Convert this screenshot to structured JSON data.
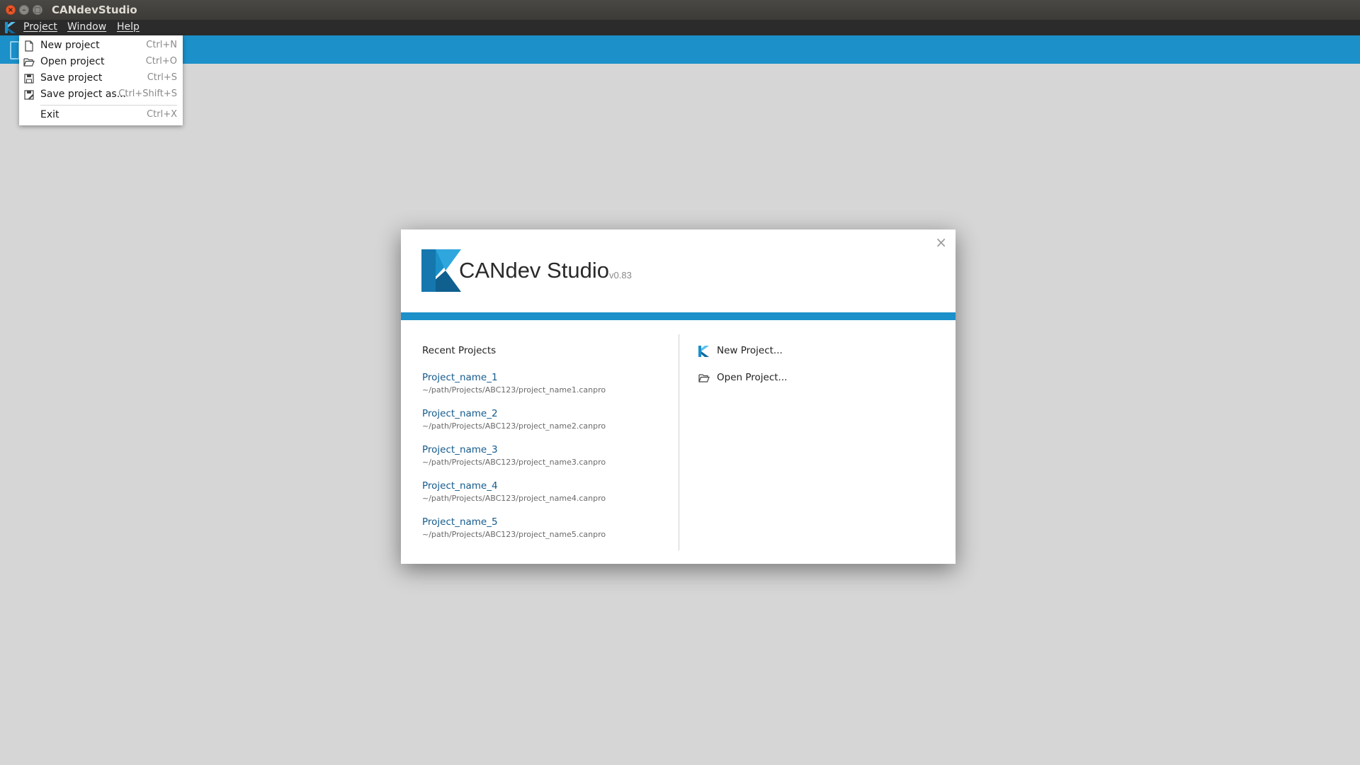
{
  "window": {
    "title": "CANdevStudio"
  },
  "menubar": {
    "items": [
      {
        "label": "Project"
      },
      {
        "label": "Window"
      },
      {
        "label": "Help"
      }
    ]
  },
  "dropdown": {
    "items": [
      {
        "label": "New project",
        "shortcut": "Ctrl+N",
        "icon": "new-file-icon"
      },
      {
        "label": "Open project",
        "shortcut": "Ctrl+O",
        "icon": "folder-open-icon"
      },
      {
        "label": "Save project",
        "shortcut": "Ctrl+S",
        "icon": "save-icon"
      },
      {
        "label": "Save project as...",
        "shortcut": "Ctrl+Shift+S",
        "icon": "save-as-icon"
      },
      {
        "label": "Exit",
        "shortcut": "Ctrl+X",
        "icon": ""
      }
    ]
  },
  "dialog": {
    "title": "CANdev Studio",
    "version": "v0.83",
    "close_glyph": "×",
    "recent_heading": "Recent Projects",
    "recent": [
      {
        "name": "Project_name_1",
        "path": "~/path/Projects/ABC123/project_name1.canpro"
      },
      {
        "name": "Project_name_2",
        "path": "~/path/Projects/ABC123/project_name2.canpro"
      },
      {
        "name": "Project_name_3",
        "path": "~/path/Projects/ABC123/project_name3.canpro"
      },
      {
        "name": "Project_name_4",
        "path": "~/path/Projects/ABC123/project_name4.canpro"
      },
      {
        "name": "Project_name_5",
        "path": "~/path/Projects/ABC123/project_name5.canpro"
      }
    ],
    "actions": [
      {
        "label": "New Project...",
        "icon": "candev-logo-icon"
      },
      {
        "label": "Open Project...",
        "icon": "folder-open-icon"
      }
    ]
  },
  "colors": {
    "accent": "#1b90c9",
    "menubar": "#2b2b2b",
    "background": "#d6d6d6",
    "link": "#145a8c"
  }
}
